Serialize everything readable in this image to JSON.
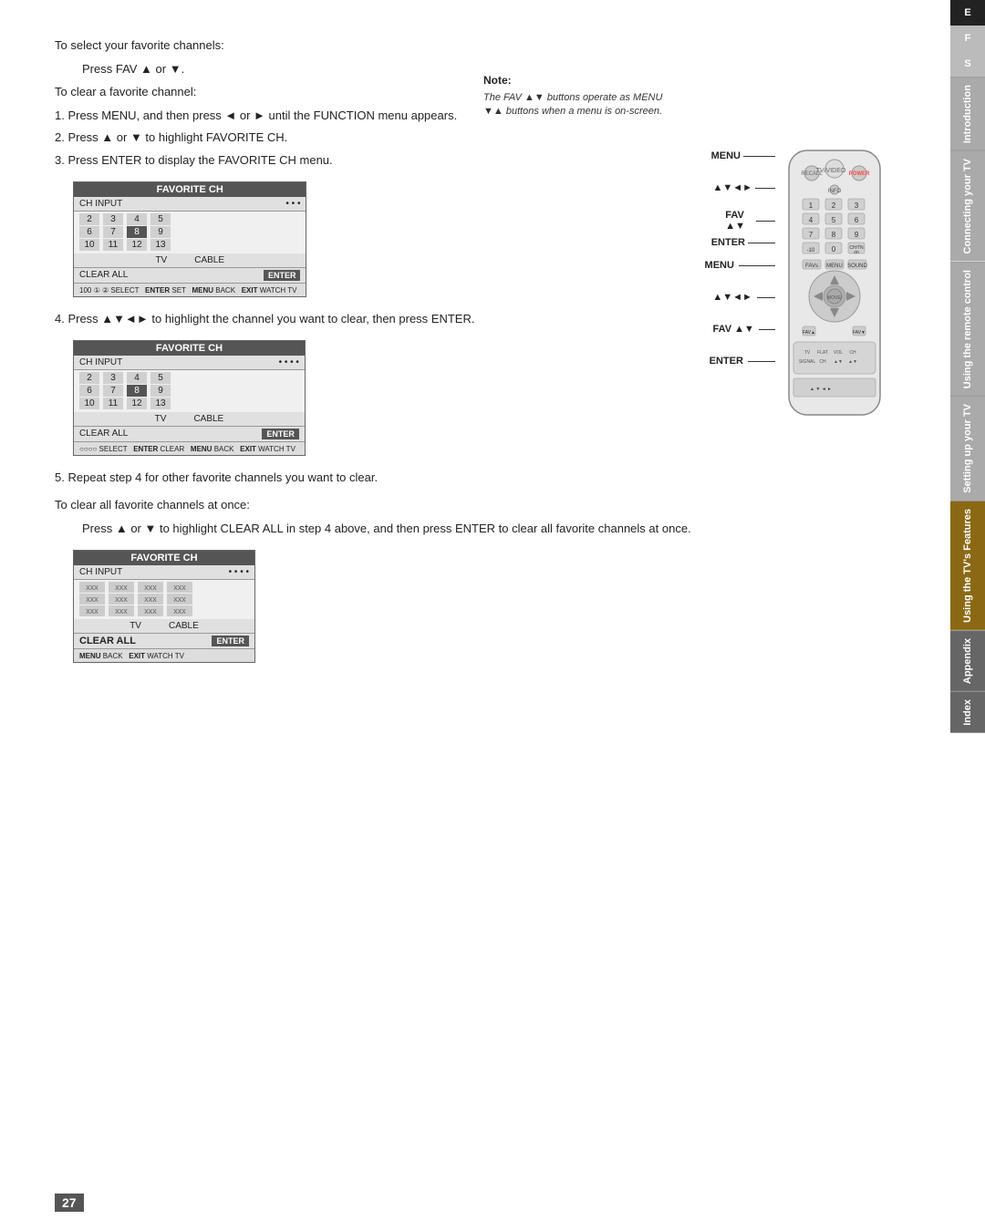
{
  "page": {
    "number": "27",
    "background": "#ffffff"
  },
  "sidebar": {
    "letters": [
      "E",
      "F",
      "S"
    ],
    "tabs": [
      {
        "label": "Introduction",
        "active": false
      },
      {
        "label": "Connecting your TV",
        "active": false
      },
      {
        "label": "Using the remote control",
        "active": false
      },
      {
        "label": "Setting up your TV",
        "active": false
      },
      {
        "label": "Using the TV's Features",
        "active": true
      },
      {
        "label": "Appendix",
        "active": false
      },
      {
        "label": "Index",
        "active": false
      }
    ]
  },
  "note": {
    "title": "Note:",
    "text": "The FAV ▲▼ buttons operate as MENU ▼▲ buttons when a menu is on-screen."
  },
  "content": {
    "intro1": "To select your favorite channels:",
    "press_fav": "Press FAV ▲ or ▼.",
    "intro2": "To clear a favorite channel:",
    "step1": "1. Press MENU, and then press ◄ or ► until the FUNCTION menu appears.",
    "step2": "2. Press ▲ or ▼ to highlight FAVORITE CH.",
    "step3": "3. Press ENTER to display the FAVORITE CH menu.",
    "step4": "4. Press ▲▼◄► to highlight the channel you want to clear, then press ENTER.",
    "step5": "5. Repeat step 4 for other favorite channels you want to clear.",
    "intro3": "To clear all favorite channels at once:",
    "clear_all_text": "Press ▲ or ▼ to highlight CLEAR ALL in step 4 above, and then press ENTER to clear all favorite channels at once."
  },
  "table1": {
    "title": "FAVORITE CH",
    "header_left": "CH INPUT",
    "header_right": "• • •",
    "rows": [
      [
        "2",
        "3",
        "4",
        "5"
      ],
      [
        "6",
        "7",
        "8",
        "9"
      ],
      [
        "10",
        "11",
        "12",
        "13"
      ]
    ],
    "highlight_cell": "8",
    "footer_left": "CLEAR ALL",
    "footer_right": "ENTER",
    "bottom": "100 ① ② SELECT  ENTER SET  MENU BACK   EXIT WATCH TV",
    "tv_cable": "TV    CABLE"
  },
  "table2": {
    "title": "FAVORITE CH",
    "header_left": "CH INPUT",
    "header_right": "• • • •",
    "rows": [
      [
        "2",
        "3",
        "4",
        "5"
      ],
      [
        "6",
        "7",
        "8",
        "9"
      ],
      [
        "10",
        "11",
        "12",
        "13"
      ]
    ],
    "highlight_cell": "8",
    "footer_left": "CLEAR ALL",
    "footer_right": "ENTER",
    "bottom": "○○○○ SELECT  ENTER CLEAR  MENU BACK   EXIT WATCH TV",
    "tv_cable": "TV    CABLE"
  },
  "table3": {
    "title": "FAVORITE CH",
    "header_left": "CH INPUT",
    "header_right": "• • • •",
    "rows_xxx": true,
    "footer_left": "CLEAR ALL",
    "footer_right": "ENTER",
    "bottom": "MENU BACK   EXIT WATCH TV",
    "tv_cable": "TV    CABLE",
    "clear_highlight": true
  },
  "remote_labels": {
    "menu": "MENU",
    "nav": "▲▼◄►",
    "fav": "FAV ▲▼",
    "enter": "ENTER"
  }
}
